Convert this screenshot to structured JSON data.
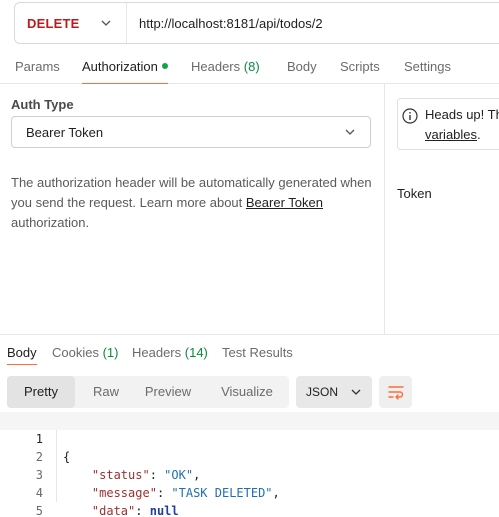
{
  "request": {
    "method": "DELETE",
    "url": "http://localhost:8181/api/todos/2"
  },
  "request_tabs": {
    "params": "Params",
    "authorization": "Authorization",
    "headers": "Headers",
    "headers_count": "(8)",
    "body": "Body",
    "scripts": "Scripts",
    "settings": "Settings"
  },
  "auth": {
    "type_label": "Auth Type",
    "type_value": "Bearer Token",
    "desc_prefix": "The authorization header will be automatically generated when you send the request. Learn more about ",
    "desc_link": "Bearer Token",
    "desc_suffix": " authorization.",
    "heads_up_title": "Heads up! Th",
    "heads_up_link": "variables",
    "heads_up_tail": ".",
    "token_label": "Token"
  },
  "response_tabs": {
    "body": "Body",
    "cookies": "Cookies",
    "cookies_count": "(1)",
    "headers": "Headers",
    "headers_count": "(14)",
    "test_results": "Test Results"
  },
  "response_view": {
    "pretty": "Pretty",
    "raw": "Raw",
    "preview": "Preview",
    "visualize": "Visualize",
    "format": "JSON"
  },
  "response_body": {
    "lines": [
      "1",
      "2",
      "3",
      "4",
      "5"
    ],
    "open": "{",
    "close": "}",
    "status_key": "\"status\"",
    "status_val": "\"OK\"",
    "message_key": "\"message\"",
    "message_val": "\"TASK DELETED\"",
    "data_key": "\"data\"",
    "data_val": "null"
  },
  "colors": {
    "accent": "#ff6c37",
    "method_delete": "#b91c1c",
    "count_green": "#0b8a3e"
  }
}
